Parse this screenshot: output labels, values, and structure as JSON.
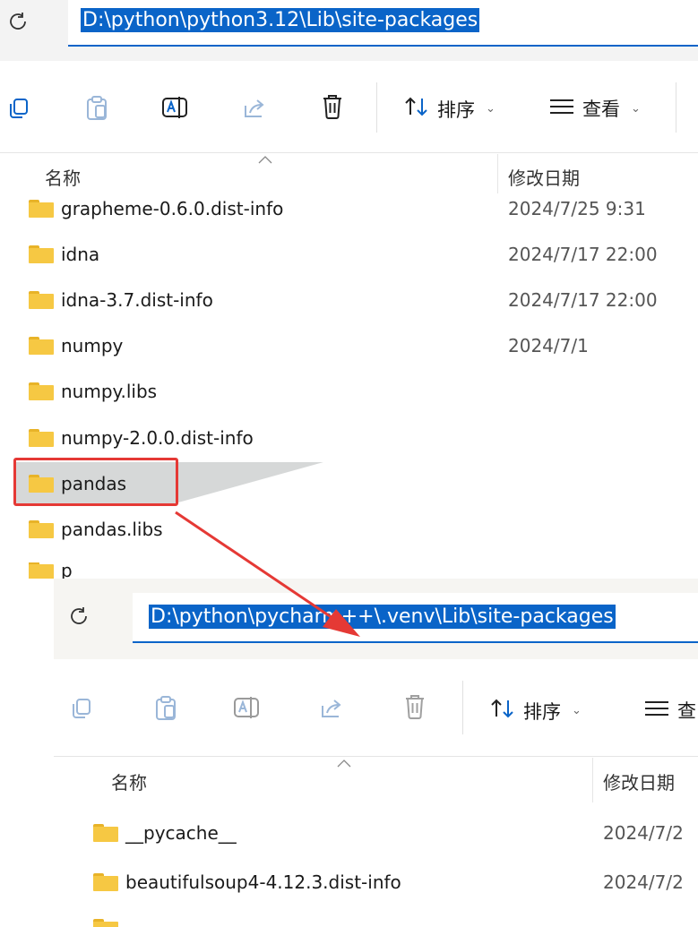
{
  "top": {
    "address": "D:\\python\\python3.12\\Lib\\site-packages",
    "toolbar": {
      "sort_label": "排序",
      "view_label": "查看"
    },
    "columns": {
      "name": "名称",
      "modified": "修改日期"
    },
    "rows": [
      {
        "name": "grapheme-0.6.0.dist-info",
        "date": "2024/7/25 9:31"
      },
      {
        "name": "idna",
        "date": "2024/7/17 22:00"
      },
      {
        "name": "idna-3.7.dist-info",
        "date": "2024/7/17 22:00"
      },
      {
        "name": "numpy",
        "date": "2024/7/1"
      },
      {
        "name": "numpy.libs",
        "date": ""
      },
      {
        "name": "numpy-2.0.0.dist-info",
        "date": ""
      },
      {
        "name": "pandas",
        "date": ""
      },
      {
        "name": "pandas.libs",
        "date": ""
      },
      {
        "name": "p",
        "date": ""
      }
    ]
  },
  "bottom": {
    "address": "D:\\python\\pycharm++\\.venv\\Lib\\site-packages",
    "toolbar": {
      "sort_label": "排序",
      "view_label": "查"
    },
    "columns": {
      "name": "名称",
      "modified": "修改日期"
    },
    "rows": [
      {
        "name": "__pycache__",
        "date": "2024/7/2"
      },
      {
        "name": "beautifulsoup4-4.12.3.dist-info",
        "date": "2024/7/2"
      }
    ]
  },
  "colors": {
    "selection": "#0a64c8",
    "highlight_box": "#e53935",
    "arrow": "#e53935",
    "folder": "#f6c843"
  }
}
